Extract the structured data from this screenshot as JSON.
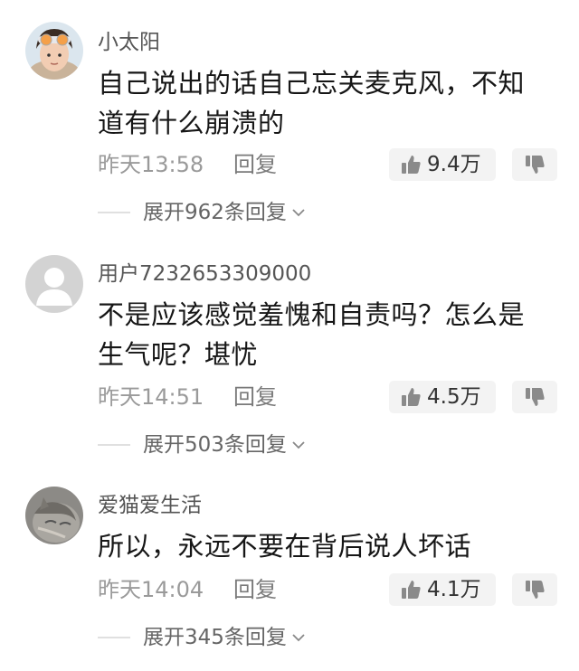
{
  "comments": [
    {
      "username": "小太阳",
      "text": "自己说出的话自己忘关麦克风，不知道有什么崩溃的",
      "time": "昨天13:58",
      "reply_label": "回复",
      "likes": "9.4万",
      "expand_label": "展开962条回复"
    },
    {
      "username": "用户7232653309000",
      "text": "不是应该感觉羞愧和自责吗？怎么是生气呢？堪忧",
      "time": "昨天14:51",
      "reply_label": "回复",
      "likes": "4.5万",
      "expand_label": "展开503条回复"
    },
    {
      "username": "爱猫爱生活",
      "text": "所以，永远不要在背后说人坏话",
      "time": "昨天14:04",
      "reply_label": "回复",
      "likes": "4.1万",
      "expand_label": "展开345条回复"
    }
  ]
}
